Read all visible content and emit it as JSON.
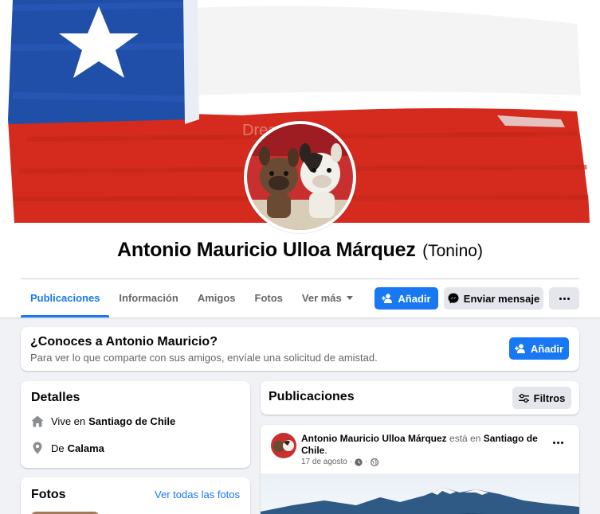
{
  "profile": {
    "name": "Antonio Mauricio Ulloa Márquez",
    "alternate_name": "(Tonino)",
    "cover_watermark": "Dreamstime"
  },
  "tabs": [
    {
      "label": "Publicaciones",
      "active": true
    },
    {
      "label": "Información",
      "active": false
    },
    {
      "label": "Amigos",
      "active": false
    },
    {
      "label": "Fotos",
      "active": false
    },
    {
      "label": "Ver más",
      "active": false
    }
  ],
  "actions": {
    "add_friend_label": "Añadir",
    "message_label": "Enviar mensaje",
    "more_icon": "ellipsis-icon"
  },
  "know_card": {
    "title": "¿Conoces a Antonio Mauricio?",
    "subtitle": "Para ver lo que comparte con sus amigos, envíale una solicitud de amistad.",
    "button_label": "Añadir"
  },
  "details": {
    "title": "Detalles",
    "lives_prefix": "Vive en",
    "lives_city": "Santiago de Chile",
    "from_prefix": "De",
    "from_city": "Calama"
  },
  "photos": {
    "title": "Fotos",
    "see_all": "Ver todas las fotos"
  },
  "posts": {
    "title": "Publicaciones",
    "filters_label": "Filtros",
    "items": [
      {
        "author": "Antonio Mauricio Ulloa Márquez",
        "action": "está en",
        "place": "Santiago de Chile",
        "date": "17 de agosto",
        "separator": "·"
      }
    ]
  },
  "colors": {
    "accent": "#1877f2",
    "page_bg": "#f0f2f5",
    "muted_text": "#65676b",
    "flag_red": "#d52b1e",
    "flag_blue": "#1f4fa8"
  }
}
